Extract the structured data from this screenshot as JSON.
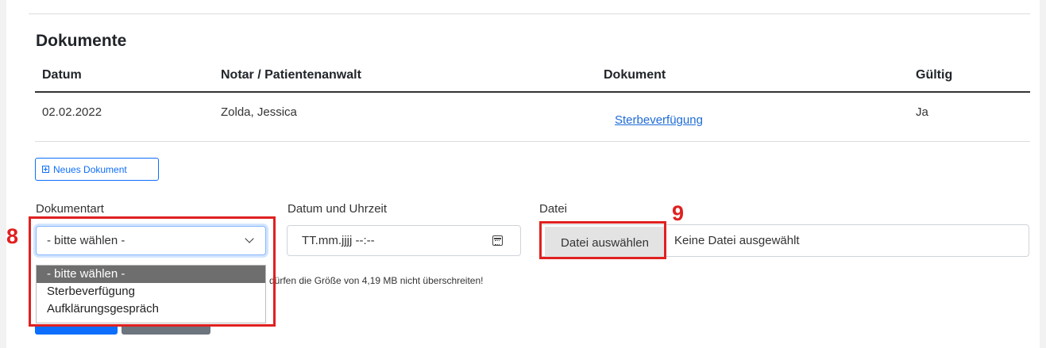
{
  "section": {
    "title": "Dokumente"
  },
  "table": {
    "headers": [
      "Datum",
      "Notar / Patientenanwalt",
      "Dokument",
      "Gültig"
    ],
    "rows": [
      {
        "datum": "02.02.2022",
        "notar": "Zolda, Jessica",
        "dokument": "Sterbeverfügung",
        "gueltig": "Ja"
      }
    ]
  },
  "new_document_button": {
    "label": "Neues Dokument"
  },
  "form": {
    "dokumentart": {
      "label": "Dokumentart",
      "selected": "- bitte wählen -",
      "options": [
        "- bitte wählen -",
        "Sterbeverfügung",
        "Aufklärungsgespräch"
      ]
    },
    "datetime": {
      "label": "Datum und Uhrzeit",
      "placeholder": "TT.mm.jjjj --:--"
    },
    "file": {
      "label": "Datei",
      "button_label": "Datei auswählen",
      "status": "Keine Datei ausgewählt"
    },
    "size_hint": "dürfen die Größe von 4,19 MB nicht überschreiten!"
  },
  "annotations": {
    "step8": "8",
    "step9": "9"
  },
  "colors": {
    "accent": "#0d6efd",
    "annotation": "#e02020",
    "link": "#1e6bd6"
  }
}
